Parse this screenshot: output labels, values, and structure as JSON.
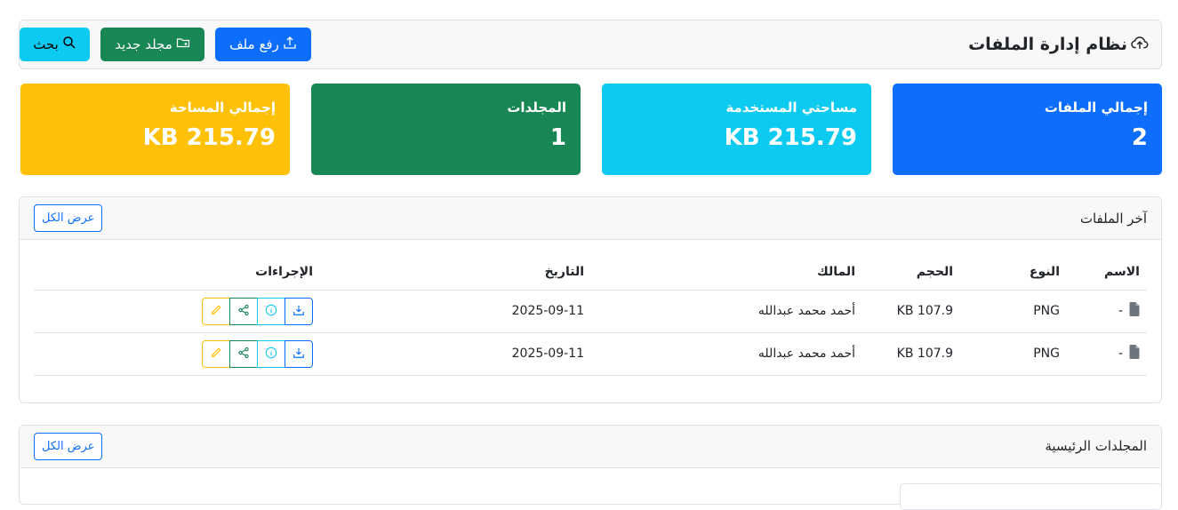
{
  "header": {
    "title": "نظام إدارة الملفات",
    "search_label": "بحث",
    "new_folder_label": "مجلد جديد",
    "upload_label": "رفع ملف"
  },
  "stats": [
    {
      "label": "إجمالي الملفات",
      "value": "2",
      "color": "#0d6efd"
    },
    {
      "label": "مساحتي المستخدمة",
      "value": "KB 215.79",
      "color": "#0dcaf0"
    },
    {
      "label": "المجلدات",
      "value": "1",
      "color": "#198754"
    },
    {
      "label": "إجمالي المساحة",
      "value": "KB 215.79",
      "color": "#ffc107"
    }
  ],
  "recent_files": {
    "title": "آخر الملفات",
    "view_all_label": "عرض الكل",
    "columns": [
      "الاسم",
      "النوع",
      "الحجم",
      "المالك",
      "التاريخ",
      "الإجراءات"
    ],
    "rows": [
      {
        "name": "-",
        "type": "PNG",
        "size": "KB 107.9",
        "owner": "أحمد محمد عبدالله",
        "date": "2025-09-11"
      },
      {
        "name": "-",
        "type": "PNG",
        "size": "KB 107.9",
        "owner": "أحمد محمد عبدالله",
        "date": "2025-09-11"
      }
    ]
  },
  "main_folders": {
    "title": "المجلدات الرئيسية",
    "view_all_label": "عرض الكل"
  }
}
